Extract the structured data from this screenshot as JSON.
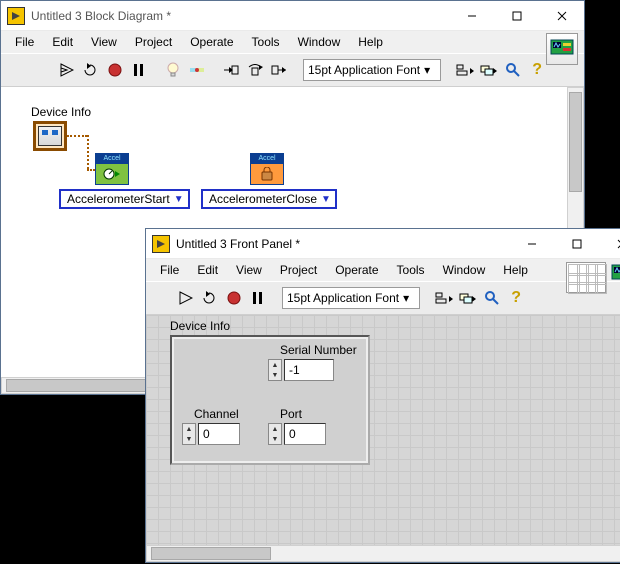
{
  "block_window": {
    "title": "Untitled 3 Block Diagram *",
    "menu": [
      "File",
      "Edit",
      "View",
      "Project",
      "Operate",
      "Tools",
      "Window",
      "Help"
    ],
    "font_label": "15pt Application Font",
    "device_info_label": "Device Info",
    "vi_start": {
      "header": "Accel Start",
      "selector": "AccelerometerStart"
    },
    "vi_close": {
      "header": "Accel CLOSE",
      "selector": "AccelerometerClose"
    }
  },
  "front_window": {
    "title": "Untitled 3 Front Panel *",
    "menu": [
      "File",
      "Edit",
      "View",
      "Project",
      "Operate",
      "Tools",
      "Window",
      "Help"
    ],
    "font_label": "15pt Application Font",
    "panel_number": "3",
    "cluster": {
      "label": "Device Info",
      "serial": {
        "label": "Serial Number",
        "value": "-1"
      },
      "channel": {
        "label": "Channel",
        "value": "0"
      },
      "port": {
        "label": "Port",
        "value": "0"
      }
    }
  },
  "icons": {
    "run": "run-arrow-icon",
    "run_cont": "run-continuous-icon",
    "abort": "abort-icon",
    "pause": "pause-icon",
    "bulb": "highlight-exec-icon",
    "retain": "retain-wire-icon",
    "step_into": "step-into-icon",
    "step_over": "step-over-icon",
    "step_out": "step-out-icon",
    "align": "align-icon",
    "distribute": "distribute-icon",
    "search": "search-icon",
    "help": "context-help-icon"
  }
}
